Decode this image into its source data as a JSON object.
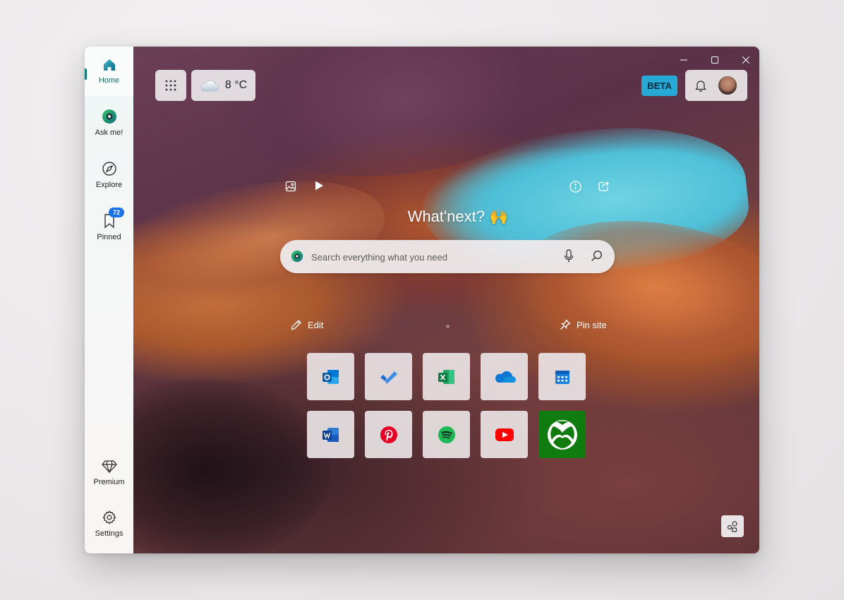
{
  "window": {
    "minimize_icon": "minimize-icon",
    "maximize_icon": "maximize-icon",
    "close_icon": "close-icon"
  },
  "sidebar": {
    "items": [
      {
        "label": "Home",
        "icon": "home-icon",
        "active": true
      },
      {
        "label": "Ask me!",
        "icon": "assistant-icon"
      },
      {
        "label": "Explore",
        "icon": "compass-icon"
      },
      {
        "label": "Pinned",
        "icon": "bookmark-icon",
        "badge": "72"
      }
    ],
    "bottom_items": [
      {
        "label": "Premium",
        "icon": "diamond-icon"
      },
      {
        "label": "Settings",
        "icon": "gear-icon"
      }
    ]
  },
  "header": {
    "weather": {
      "temperature": "8 °C",
      "icon": "cloud-icon"
    },
    "beta_label": "BETA",
    "notification_icon": "bell-icon"
  },
  "hero": {
    "headline": "What'next? 🙌",
    "background_icon": "image-icon",
    "play_icon": "play-icon",
    "info_icon": "info-icon",
    "share_icon": "share-icon"
  },
  "search": {
    "placeholder": "Search everything what you need",
    "value": "",
    "mic_icon": "microphone-icon",
    "search_icon": "search-icon"
  },
  "actions": {
    "edit_label": "Edit",
    "pin_label": "Pin site"
  },
  "shortcuts": [
    {
      "name": "Outlook",
      "icon": "outlook-icon"
    },
    {
      "name": "To Do",
      "icon": "todo-icon"
    },
    {
      "name": "Excel",
      "icon": "excel-icon"
    },
    {
      "name": "OneDrive",
      "icon": "onedrive-icon"
    },
    {
      "name": "Calendar",
      "icon": "calendar-icon"
    },
    {
      "name": "Word",
      "icon": "word-icon"
    },
    {
      "name": "Pinterest",
      "icon": "pinterest-icon"
    },
    {
      "name": "Spotify",
      "icon": "spotify-icon"
    },
    {
      "name": "YouTube",
      "icon": "youtube-icon"
    },
    {
      "name": "Xbox",
      "icon": "xbox-icon"
    }
  ],
  "colors": {
    "accent_teal": "#0f7d76",
    "beta_bg": "#27a9d6",
    "badge_blue": "#1a73e8"
  }
}
